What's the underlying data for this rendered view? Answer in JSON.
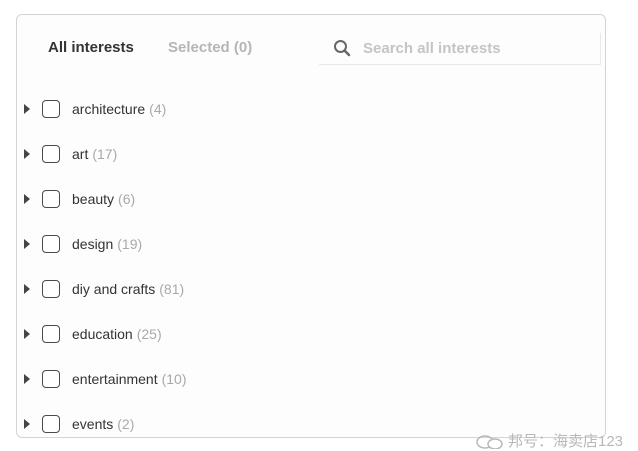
{
  "tabs": [
    {
      "label": "All interests",
      "active": true
    },
    {
      "label": "Selected (0)",
      "active": false
    }
  ],
  "search": {
    "placeholder": "Search all interests",
    "value": "",
    "icon": "search-icon"
  },
  "interests": [
    {
      "name": "architecture",
      "count": "(4)",
      "checked": false
    },
    {
      "name": "art",
      "count": "(17)",
      "checked": false
    },
    {
      "name": "beauty",
      "count": "(6)",
      "checked": false
    },
    {
      "name": "design",
      "count": "(19)",
      "checked": false
    },
    {
      "name": "diy and crafts",
      "count": "(81)",
      "checked": false
    },
    {
      "name": "education",
      "count": "(25)",
      "checked": false
    },
    {
      "name": "entertainment",
      "count": "(10)",
      "checked": false
    },
    {
      "name": "events",
      "count": "(2)",
      "checked": false
    }
  ],
  "watermark": {
    "text": "邦号：海卖店123",
    "icon": "wechat-icon"
  },
  "colors": {
    "text": "#333333",
    "muted": "#b5b5b5",
    "count": "#a9a9a9",
    "border": "#d4d4d4"
  }
}
